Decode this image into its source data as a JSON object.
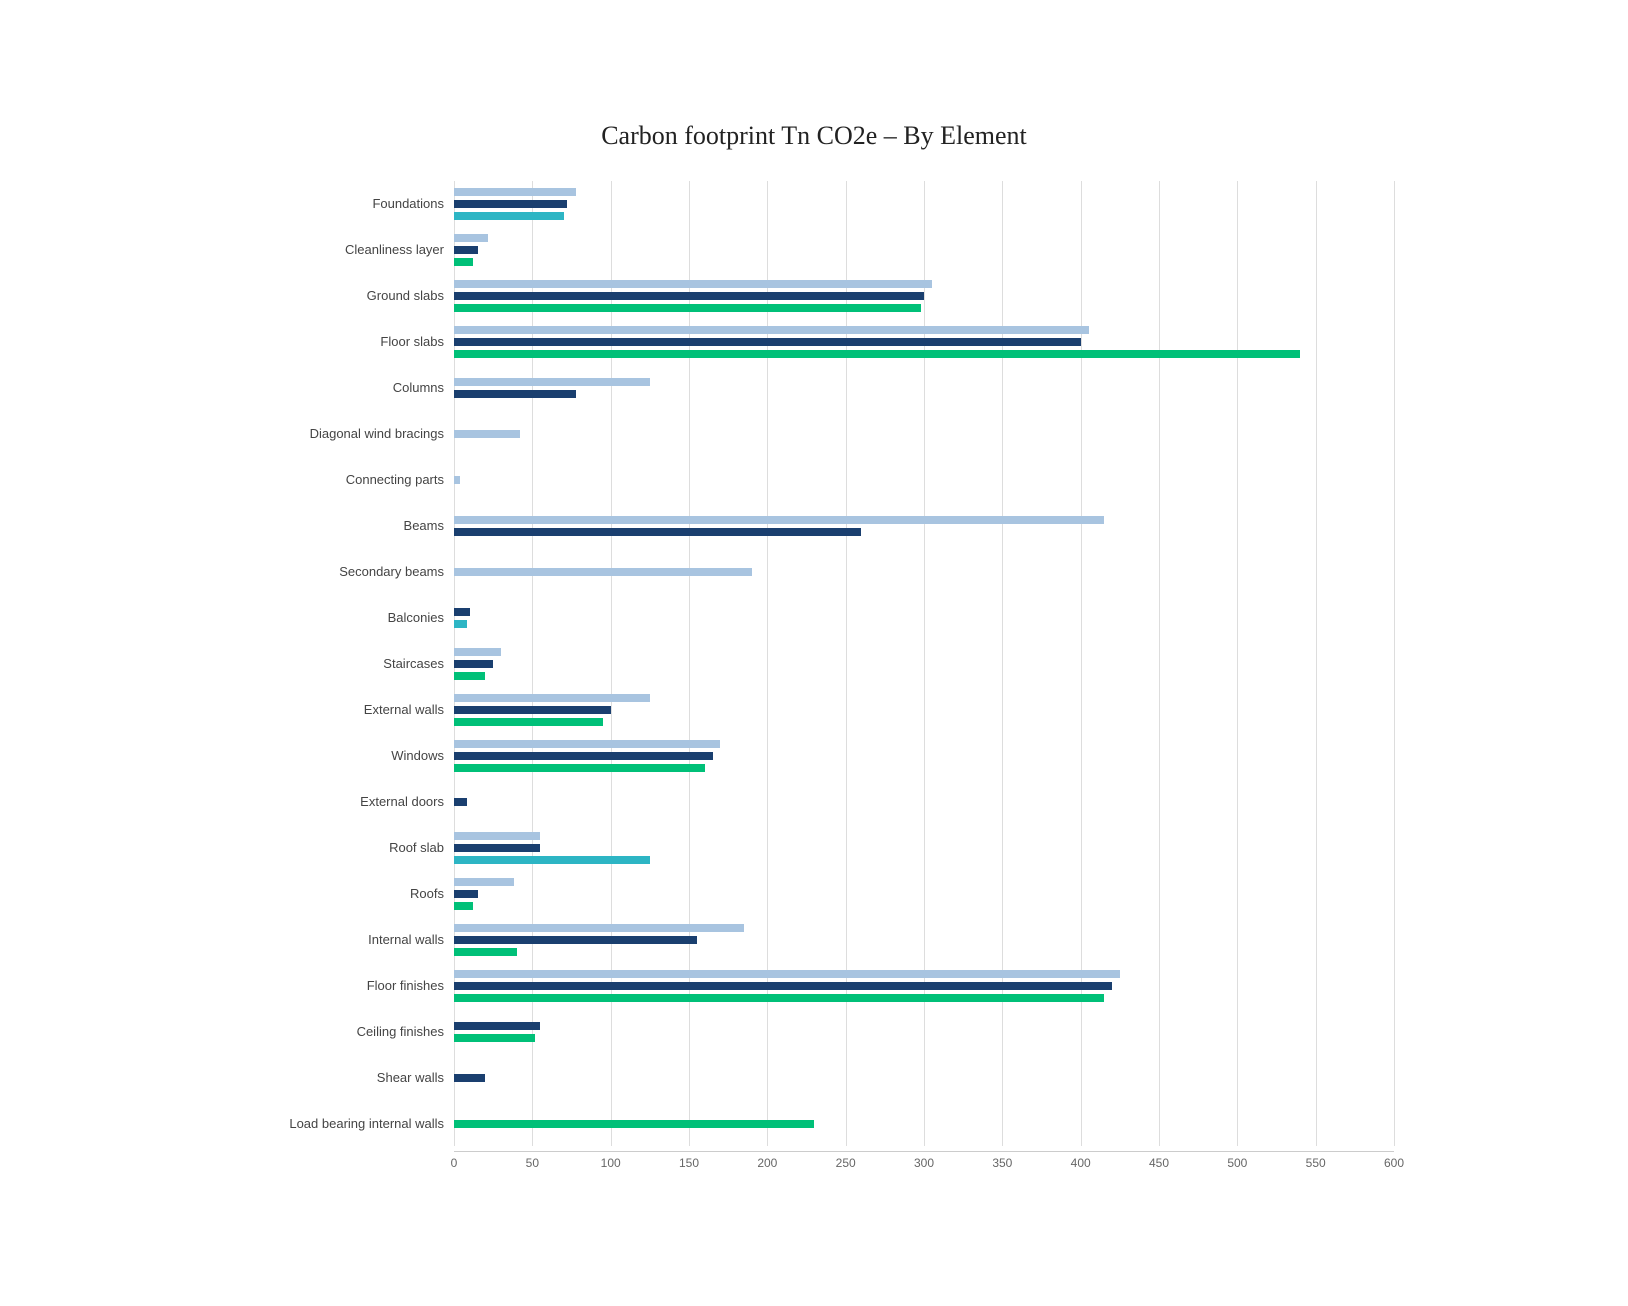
{
  "title": "Carbon footprint Tn CO2e – By Element",
  "maxValue": 600,
  "xTicks": [
    0,
    50,
    100,
    150,
    200,
    250,
    300,
    350,
    400,
    450,
    500,
    550,
    600
  ],
  "colors": {
    "lightBlue": "#a8c4e0",
    "darkBlue": "#1a3f6f",
    "green": "#00c078",
    "teal": "#2db5c4"
  },
  "rows": [
    {
      "label": "Foundations",
      "bars": [
        {
          "color": "lightBlue",
          "value": 78
        },
        {
          "color": "darkBlue",
          "value": 72
        },
        {
          "color": "teal",
          "value": 70
        }
      ]
    },
    {
      "label": "Cleanliness layer",
      "bars": [
        {
          "color": "lightBlue",
          "value": 22
        },
        {
          "color": "darkBlue",
          "value": 15
        },
        {
          "color": "green",
          "value": 12
        }
      ]
    },
    {
      "label": "Ground slabs",
      "bars": [
        {
          "color": "lightBlue",
          "value": 305
        },
        {
          "color": "darkBlue",
          "value": 300
        },
        {
          "color": "green",
          "value": 298
        }
      ]
    },
    {
      "label": "Floor slabs",
      "bars": [
        {
          "color": "lightBlue",
          "value": 405
        },
        {
          "color": "darkBlue",
          "value": 400
        },
        {
          "color": "green",
          "value": 540
        }
      ]
    },
    {
      "label": "Columns",
      "bars": [
        {
          "color": "lightBlue",
          "value": 125
        },
        {
          "color": "darkBlue",
          "value": 78
        },
        {
          "color": "teal",
          "value": 0
        }
      ]
    },
    {
      "label": "Diagonal wind bracings",
      "bars": [
        {
          "color": "lightBlue",
          "value": 42
        },
        {
          "color": "darkBlue",
          "value": 0
        },
        {
          "color": "teal",
          "value": 0
        }
      ]
    },
    {
      "label": "Connecting parts",
      "bars": [
        {
          "color": "lightBlue",
          "value": 4
        },
        {
          "color": "darkBlue",
          "value": 0
        },
        {
          "color": "teal",
          "value": 0
        }
      ]
    },
    {
      "label": "Beams",
      "bars": [
        {
          "color": "lightBlue",
          "value": 415
        },
        {
          "color": "darkBlue",
          "value": 260
        },
        {
          "color": "teal",
          "value": 0
        }
      ]
    },
    {
      "label": "Secondary beams",
      "bars": [
        {
          "color": "lightBlue",
          "value": 190
        },
        {
          "color": "darkBlue",
          "value": 0
        },
        {
          "color": "teal",
          "value": 0
        }
      ]
    },
    {
      "label": "Balconies",
      "bars": [
        {
          "color": "lightBlue",
          "value": 0
        },
        {
          "color": "darkBlue",
          "value": 10
        },
        {
          "color": "teal",
          "value": 8
        }
      ]
    },
    {
      "label": "Staircases",
      "bars": [
        {
          "color": "lightBlue",
          "value": 30
        },
        {
          "color": "darkBlue",
          "value": 25
        },
        {
          "color": "green",
          "value": 20
        }
      ]
    },
    {
      "label": "External walls",
      "bars": [
        {
          "color": "lightBlue",
          "value": 125
        },
        {
          "color": "darkBlue",
          "value": 100
        },
        {
          "color": "green",
          "value": 95
        }
      ]
    },
    {
      "label": "Windows",
      "bars": [
        {
          "color": "lightBlue",
          "value": 170
        },
        {
          "color": "darkBlue",
          "value": 165
        },
        {
          "color": "green",
          "value": 160
        }
      ]
    },
    {
      "label": "External doors",
      "bars": [
        {
          "color": "lightBlue",
          "value": 0
        },
        {
          "color": "darkBlue",
          "value": 8
        },
        {
          "color": "teal",
          "value": 0
        }
      ]
    },
    {
      "label": "Roof slab",
      "bars": [
        {
          "color": "lightBlue",
          "value": 55
        },
        {
          "color": "darkBlue",
          "value": 55
        },
        {
          "color": "teal",
          "value": 125
        }
      ]
    },
    {
      "label": "Roofs",
      "bars": [
        {
          "color": "lightBlue",
          "value": 38
        },
        {
          "color": "darkBlue",
          "value": 15
        },
        {
          "color": "green",
          "value": 12
        }
      ]
    },
    {
      "label": "Internal walls",
      "bars": [
        {
          "color": "lightBlue",
          "value": 185
        },
        {
          "color": "darkBlue",
          "value": 155
        },
        {
          "color": "green",
          "value": 40
        }
      ]
    },
    {
      "label": "Floor finishes",
      "bars": [
        {
          "color": "lightBlue",
          "value": 425
        },
        {
          "color": "darkBlue",
          "value": 420
        },
        {
          "color": "green",
          "value": 415
        }
      ]
    },
    {
      "label": "Ceiling finishes",
      "bars": [
        {
          "color": "lightBlue",
          "value": 0
        },
        {
          "color": "darkBlue",
          "value": 55
        },
        {
          "color": "green",
          "value": 52
        }
      ]
    },
    {
      "label": "Shear walls",
      "bars": [
        {
          "color": "lightBlue",
          "value": 0
        },
        {
          "color": "darkBlue",
          "value": 20
        },
        {
          "color": "teal",
          "value": 0
        }
      ]
    },
    {
      "label": "Load bearing internal walls",
      "bars": [
        {
          "color": "lightBlue",
          "value": 0
        },
        {
          "color": "darkBlue",
          "value": 0
        },
        {
          "color": "green",
          "value": 230
        }
      ]
    }
  ]
}
